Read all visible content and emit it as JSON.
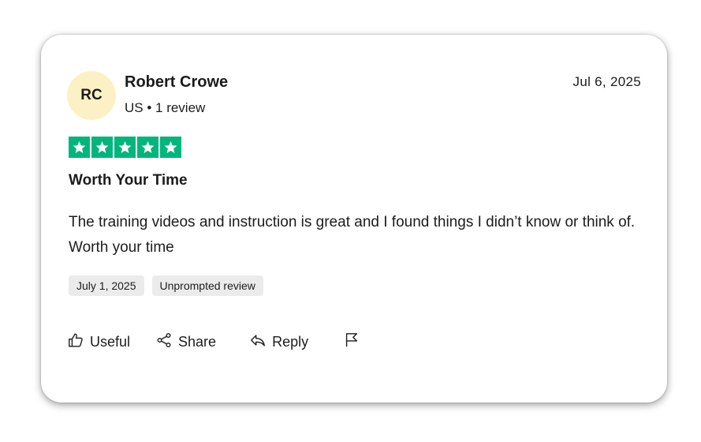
{
  "review": {
    "avatar_initials": "RC",
    "author_name": "Robert Crowe",
    "author_meta": "US • 1 review",
    "date": "Jul 6, 2025",
    "rating": 5,
    "rating_max": 5,
    "star_color": "#00b67a",
    "title": "Worth Your Time",
    "body": "The training videos and instruction is great and I found things I didn’t know or think of. Worth your time",
    "tags": {
      "experience_date": "July 1, 2025",
      "review_type": "Unprompted review"
    }
  },
  "actions": {
    "useful_label": "Useful",
    "share_label": "Share",
    "reply_label": "Reply",
    "useful_icon": "thumbs-up-icon",
    "share_icon": "share-icon",
    "reply_icon": "reply-icon",
    "flag_icon": "flag-icon"
  }
}
